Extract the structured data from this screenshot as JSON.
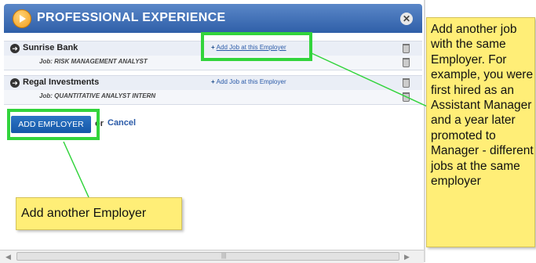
{
  "panel": {
    "title": "PROFESSIONAL EXPERIENCE",
    "close_symbol": "✕"
  },
  "employers": [
    {
      "name": "Sunrise Bank",
      "add_job_label": "Add Job at this Employer",
      "job": "Job: RISK MANAGEMENT ANALYST"
    },
    {
      "name": "Regal Investments",
      "add_job_label": "Add Job at this Employer",
      "job": "Job: QUANTITATIVE ANALYST INTERN"
    }
  ],
  "actions": {
    "add_employer_label": "ADD EMPLOYER",
    "or_text": "or",
    "cancel_label": "Cancel"
  },
  "callouts": {
    "left": "Add another Employer",
    "right": "Add another job with the same Employer.  For example, you were first hired as an Assistant Manager and a year later promoted to Manager - different jobs at the same employer"
  },
  "icons": {
    "header_logo": "play-circle-icon",
    "close": "close-circle-icon",
    "employer_bullet": "arrow-right-circle-icon",
    "trash": "trash-icon",
    "plus": "plus-icon"
  },
  "colors": {
    "header": "#2f5fa8",
    "highlight": "#32d43c",
    "callout": "#ffee77",
    "link": "#2a5aa8"
  }
}
